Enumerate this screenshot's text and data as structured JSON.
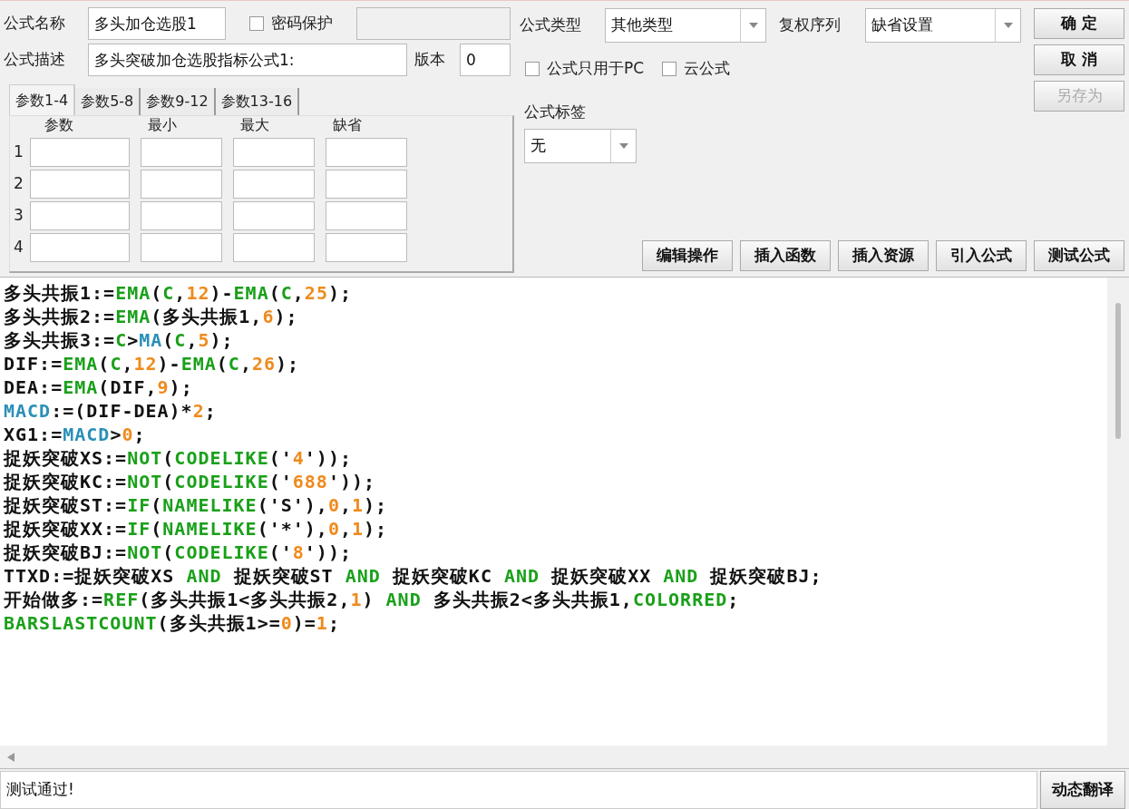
{
  "header": {
    "name_label": "公式名称",
    "name_value": "多头加仓选股1",
    "password": {
      "label": "密码保护",
      "checked": false
    },
    "desc_label": "公式描述",
    "desc_value": "多头突破加仓选股指标公式1:",
    "version_label": "版本",
    "version_value": "0"
  },
  "param_tabs": [
    {
      "label": "参数1-4",
      "selected": true
    },
    {
      "label": "参数5-8",
      "selected": false
    },
    {
      "label": "参数9-12",
      "selected": false
    },
    {
      "label": "参数13-16",
      "selected": false
    }
  ],
  "param_columns": [
    "参数",
    "最小",
    "最大",
    "缺省"
  ],
  "param_rows": [
    "1",
    "2",
    "3",
    "4"
  ],
  "type": {
    "label": "公式类型",
    "value": "其他类型"
  },
  "rights": {
    "label": "复权序列",
    "value": "缺省设置"
  },
  "options": [
    {
      "label": "公式只用于PC",
      "checked": false
    },
    {
      "label": "云公式",
      "checked": false
    }
  ],
  "tag": {
    "label": "公式标签",
    "value": "无"
  },
  "side_buttons": [
    {
      "label": "确 定",
      "disabled": false
    },
    {
      "label": "取 消",
      "disabled": false
    },
    {
      "label": "另存为",
      "disabled": true
    }
  ],
  "tool_buttons": [
    "编辑操作",
    "插入函数",
    "插入资源",
    "引入公式",
    "测试公式"
  ],
  "code_lines": [
    [
      {
        "kind": "text",
        "text": "多头共振1:="
      },
      {
        "kind": "func",
        "text": "EMA"
      },
      {
        "kind": "text",
        "text": "("
      },
      {
        "kind": "func",
        "text": "C"
      },
      {
        "kind": "text",
        "text": ","
      },
      {
        "kind": "num",
        "text": "12"
      },
      {
        "kind": "text",
        "text": ")-"
      },
      {
        "kind": "func",
        "text": "EMA"
      },
      {
        "kind": "text",
        "text": "("
      },
      {
        "kind": "func",
        "text": "C"
      },
      {
        "kind": "text",
        "text": ","
      },
      {
        "kind": "num",
        "text": "25"
      },
      {
        "kind": "text",
        "text": ");"
      }
    ],
    [
      {
        "kind": "text",
        "text": "多头共振2:="
      },
      {
        "kind": "func",
        "text": "EMA"
      },
      {
        "kind": "text",
        "text": "(多头共振1,"
      },
      {
        "kind": "num",
        "text": "6"
      },
      {
        "kind": "text",
        "text": ");"
      }
    ],
    [
      {
        "kind": "text",
        "text": "多头共振3:="
      },
      {
        "kind": "func",
        "text": "C"
      },
      {
        "kind": "text",
        "text": ">"
      },
      {
        "kind": "var",
        "text": "MA"
      },
      {
        "kind": "text",
        "text": "("
      },
      {
        "kind": "func",
        "text": "C"
      },
      {
        "kind": "text",
        "text": ","
      },
      {
        "kind": "num",
        "text": "5"
      },
      {
        "kind": "text",
        "text": ");"
      }
    ],
    [
      {
        "kind": "text",
        "text": "DIF:="
      },
      {
        "kind": "func",
        "text": "EMA"
      },
      {
        "kind": "text",
        "text": "("
      },
      {
        "kind": "func",
        "text": "C"
      },
      {
        "kind": "text",
        "text": ","
      },
      {
        "kind": "num",
        "text": "12"
      },
      {
        "kind": "text",
        "text": ")-"
      },
      {
        "kind": "func",
        "text": "EMA"
      },
      {
        "kind": "text",
        "text": "("
      },
      {
        "kind": "func",
        "text": "C"
      },
      {
        "kind": "text",
        "text": ","
      },
      {
        "kind": "num",
        "text": "26"
      },
      {
        "kind": "text",
        "text": ");"
      }
    ],
    [
      {
        "kind": "text",
        "text": "DEA:="
      },
      {
        "kind": "func",
        "text": "EMA"
      },
      {
        "kind": "text",
        "text": "(DIF,"
      },
      {
        "kind": "num",
        "text": "9"
      },
      {
        "kind": "text",
        "text": ");"
      }
    ],
    [
      {
        "kind": "var",
        "text": "MACD"
      },
      {
        "kind": "text",
        "text": ":=(DIF-DEA)*"
      },
      {
        "kind": "num",
        "text": "2"
      },
      {
        "kind": "text",
        "text": ";"
      }
    ],
    [
      {
        "kind": "text",
        "text": "XG1:="
      },
      {
        "kind": "var",
        "text": "MACD"
      },
      {
        "kind": "text",
        "text": ">"
      },
      {
        "kind": "num",
        "text": "0"
      },
      {
        "kind": "text",
        "text": ";"
      }
    ],
    [
      {
        "kind": "text",
        "text": "捉妖突破XS:="
      },
      {
        "kind": "func",
        "text": "NOT"
      },
      {
        "kind": "text",
        "text": "("
      },
      {
        "kind": "func",
        "text": "CODELIKE"
      },
      {
        "kind": "text",
        "text": "('"
      },
      {
        "kind": "num",
        "text": "4"
      },
      {
        "kind": "text",
        "text": "'));"
      }
    ],
    [
      {
        "kind": "text",
        "text": "捉妖突破KC:="
      },
      {
        "kind": "func",
        "text": "NOT"
      },
      {
        "kind": "text",
        "text": "("
      },
      {
        "kind": "func",
        "text": "CODELIKE"
      },
      {
        "kind": "text",
        "text": "('"
      },
      {
        "kind": "num",
        "text": "688"
      },
      {
        "kind": "text",
        "text": "'));"
      }
    ],
    [
      {
        "kind": "text",
        "text": "捉妖突破ST:="
      },
      {
        "kind": "func",
        "text": "IF"
      },
      {
        "kind": "text",
        "text": "("
      },
      {
        "kind": "func",
        "text": "NAMELIKE"
      },
      {
        "kind": "text",
        "text": "('S'),"
      },
      {
        "kind": "num",
        "text": "0"
      },
      {
        "kind": "text",
        "text": ","
      },
      {
        "kind": "num",
        "text": "1"
      },
      {
        "kind": "text",
        "text": ");"
      }
    ],
    [
      {
        "kind": "text",
        "text": "捉妖突破XX:="
      },
      {
        "kind": "func",
        "text": "IF"
      },
      {
        "kind": "text",
        "text": "("
      },
      {
        "kind": "func",
        "text": "NAMELIKE"
      },
      {
        "kind": "text",
        "text": "('*'),"
      },
      {
        "kind": "num",
        "text": "0"
      },
      {
        "kind": "text",
        "text": ","
      },
      {
        "kind": "num",
        "text": "1"
      },
      {
        "kind": "text",
        "text": ");"
      }
    ],
    [
      {
        "kind": "text",
        "text": "捉妖突破BJ:="
      },
      {
        "kind": "func",
        "text": "NOT"
      },
      {
        "kind": "text",
        "text": "("
      },
      {
        "kind": "func",
        "text": "CODELIKE"
      },
      {
        "kind": "text",
        "text": "('"
      },
      {
        "kind": "num",
        "text": "8"
      },
      {
        "kind": "text",
        "text": "'));"
      }
    ],
    [
      {
        "kind": "text",
        "text": "TTXD:=捉妖突破XS "
      },
      {
        "kind": "func",
        "text": "AND"
      },
      {
        "kind": "text",
        "text": " 捉妖突破ST "
      },
      {
        "kind": "func",
        "text": "AND"
      },
      {
        "kind": "text",
        "text": " 捉妖突破KC "
      },
      {
        "kind": "func",
        "text": "AND"
      },
      {
        "kind": "text",
        "text": " 捉妖突破XX "
      },
      {
        "kind": "func",
        "text": "AND"
      },
      {
        "kind": "text",
        "text": " 捉妖突破BJ;"
      }
    ],
    [
      {
        "kind": "text",
        "text": "开始做多:="
      },
      {
        "kind": "func",
        "text": "REF"
      },
      {
        "kind": "text",
        "text": "(多头共振1<多头共振2,"
      },
      {
        "kind": "num",
        "text": "1"
      },
      {
        "kind": "text",
        "text": ") "
      },
      {
        "kind": "func",
        "text": "AND"
      },
      {
        "kind": "text",
        "text": " 多头共振2<多头共振1,"
      },
      {
        "kind": "func",
        "text": "COLORRED"
      },
      {
        "kind": "text",
        "text": ";"
      }
    ],
    [
      {
        "kind": "func",
        "text": "BARSLASTCOUNT"
      },
      {
        "kind": "text",
        "text": "(多头共振1>="
      },
      {
        "kind": "num",
        "text": "0"
      },
      {
        "kind": "text",
        "text": ")="
      },
      {
        "kind": "num",
        "text": "1"
      },
      {
        "kind": "text",
        "text": ";"
      }
    ]
  ],
  "status": {
    "message": "测试通过!",
    "button": "动态翻译"
  }
}
